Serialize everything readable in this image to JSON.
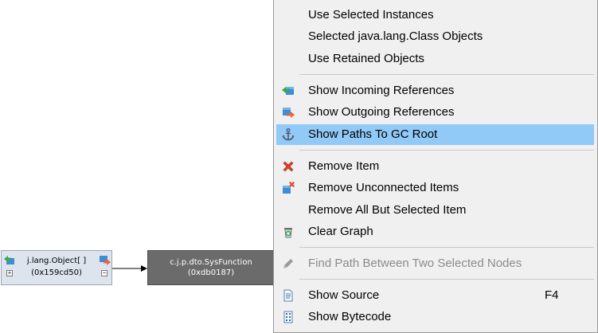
{
  "graph": {
    "object_node": {
      "line1": "j.lang.Object[ ]",
      "line2": "(0x159cd50)",
      "expand_left": "+",
      "expand_right": "−"
    },
    "function_node": {
      "line1": "c.j.p.dto.SysFunction",
      "line2": "(0xdb0187)"
    }
  },
  "menu": {
    "use_selected_instances": "Use Selected Instances",
    "selected_class_objects": "Selected java.lang.Class Objects",
    "use_retained_objects": "Use Retained Objects",
    "show_incoming_references": "Show Incoming References",
    "show_outgoing_references": "Show Outgoing References",
    "show_paths_to_gc_root": "Show Paths To GC Root",
    "remove_item": "Remove Item",
    "remove_unconnected_items": "Remove Unconnected Items",
    "remove_all_but_selected": "Remove All But Selected Item",
    "clear_graph": "Clear Graph",
    "find_path_between": "Find Path Between Two Selected Nodes",
    "show_source": "Show Source",
    "show_source_shortcut": "F4",
    "show_bytecode": "Show Bytecode"
  },
  "colors": {
    "highlight": "#91c9f7",
    "menu_background": "#f0f0f0",
    "function_node": "#6b6b6b",
    "object_node": "#dde4ee",
    "disabled_text": "#8c8c8c"
  },
  "icons": {
    "incoming": "incoming-references-icon",
    "outgoing": "outgoing-references-icon",
    "gc_root": "anchor-icon",
    "remove": "red-x-icon",
    "remove_unconnected": "remove-unconnected-icon",
    "clear": "recycle-bin-icon",
    "find_path": "pencil-icon",
    "source": "source-file-icon",
    "bytecode": "bytecode-icon"
  }
}
